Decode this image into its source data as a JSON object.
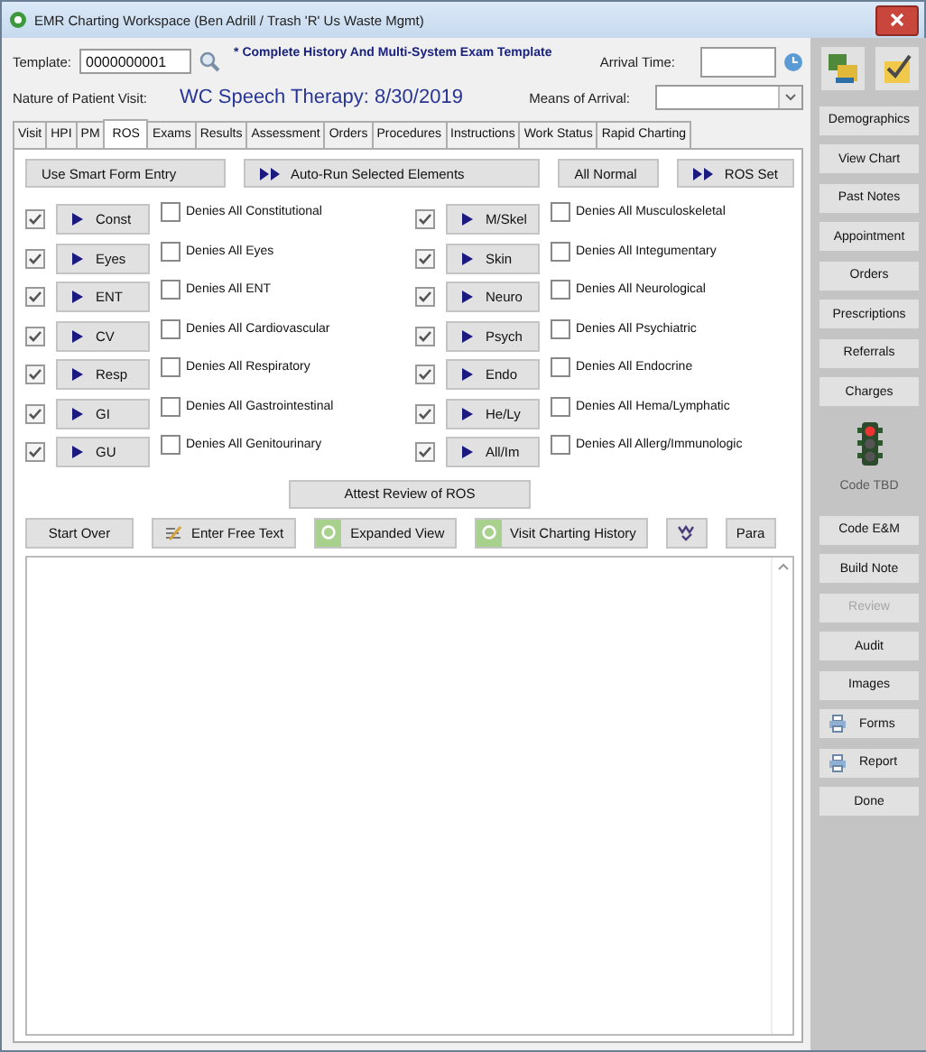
{
  "window": {
    "title": "EMR Charting Workspace (Ben Adrill / Trash 'R' Us Waste Mgmt)"
  },
  "header": {
    "template_label": "Template:",
    "template_value": "0000000001",
    "template_name": "* Complete History And Multi-System Exam Template",
    "arrival_time_label": "Arrival Time:",
    "nature_label": "Nature of Patient Visit:",
    "nature_value": "WC Speech Therapy:  8/30/2019",
    "means_label": "Means of Arrival:"
  },
  "tabs": [
    {
      "label": "Visit",
      "selected": false
    },
    {
      "label": "HPI",
      "selected": false
    },
    {
      "label": "PM",
      "selected": false
    },
    {
      "label": "ROS",
      "selected": true
    },
    {
      "label": "Exams",
      "selected": false
    },
    {
      "label": "Results",
      "selected": false
    },
    {
      "label": "Assessment",
      "selected": false
    },
    {
      "label": "Orders",
      "selected": false
    },
    {
      "label": "Procedures",
      "selected": false
    },
    {
      "label": "Instructions",
      "selected": false
    },
    {
      "label": "Work Status",
      "selected": false
    },
    {
      "label": "Rapid Charting",
      "selected": false
    }
  ],
  "ros_buttons": [
    {
      "label": "Use Smart Form Entry",
      "kind": "plain"
    },
    {
      "label": "Auto-Run Selected Elements",
      "kind": "run"
    },
    {
      "label": "All Normal",
      "kind": "plain"
    },
    {
      "label": "ROS Set",
      "kind": "run"
    }
  ],
  "systems": [
    {
      "label": "Const",
      "checked": true,
      "denies": "Denies All Constitutional",
      "denies_checked": false
    },
    {
      "label": "Eyes",
      "checked": true,
      "denies": "Denies All Eyes",
      "denies_checked": false
    },
    {
      "label": "ENT",
      "checked": true,
      "denies": "Denies All ENT",
      "denies_checked": false
    },
    {
      "label": "CV",
      "checked": true,
      "denies": "Denies All Cardiovascular",
      "denies_checked": false
    },
    {
      "label": "Resp",
      "checked": true,
      "denies": "Denies All Respiratory",
      "denies_checked": false
    },
    {
      "label": "GI",
      "checked": true,
      "denies": "Denies All Gastrointestinal",
      "denies_checked": false
    },
    {
      "label": "GU",
      "checked": true,
      "denies": "Denies All Genitourinary",
      "denies_checked": false
    },
    {
      "label": "M/Skel",
      "checked": true,
      "denies": "Denies All Musculoskeletal",
      "denies_checked": false
    },
    {
      "label": "Skin",
      "checked": true,
      "denies": "Denies All Integumentary",
      "denies_checked": false
    },
    {
      "label": "Neuro",
      "checked": true,
      "denies": "Denies All Neurological",
      "denies_checked": false
    },
    {
      "label": "Psych",
      "checked": true,
      "denies": "Denies All Psychiatric",
      "denies_checked": false
    },
    {
      "label": "Endo",
      "checked": true,
      "denies": "Denies All Endocrine",
      "denies_checked": false
    },
    {
      "label": "He/Ly",
      "checked": true,
      "denies": "Denies All Hema/Lymphatic",
      "denies_checked": false
    },
    {
      "label": "All/Im",
      "checked": true,
      "denies": "Denies All Allerg/Immunologic",
      "denies_checked": false
    }
  ],
  "attest_button": "Attest Review of ROS",
  "toolbar": [
    {
      "label": "Start Over",
      "kind": "plain"
    },
    {
      "label": "Enter Free Text",
      "kind": "pen"
    },
    {
      "label": "Expanded View",
      "kind": "green"
    },
    {
      "label": "Visit Charting History",
      "kind": "green"
    },
    {
      "kind": "spell"
    },
    {
      "label": "Para",
      "kind": "plain"
    }
  ],
  "sidebar": [
    {
      "label": "Demographics",
      "kind": "button",
      "disabled": false
    },
    {
      "label": "View Chart",
      "kind": "button",
      "disabled": false
    },
    {
      "label": "Past Notes",
      "kind": "button",
      "disabled": false
    },
    {
      "label": "Appointment",
      "kind": "button",
      "disabled": false
    },
    {
      "label": "Orders",
      "kind": "button",
      "disabled": false
    },
    {
      "label": "Prescriptions",
      "kind": "button",
      "disabled": false
    },
    {
      "label": "Referrals",
      "kind": "button",
      "disabled": false
    },
    {
      "label": "Charges",
      "kind": "button",
      "disabled": false
    },
    {
      "kind": "light"
    },
    {
      "label": "Code TBD",
      "kind": "status"
    },
    {
      "label": "Code E&M",
      "kind": "button",
      "disabled": false
    },
    {
      "label": "Build Note",
      "kind": "button",
      "disabled": false
    },
    {
      "label": "Review",
      "kind": "button",
      "disabled": true
    },
    {
      "label": "Audit",
      "kind": "button",
      "disabled": false
    },
    {
      "label": "Images",
      "kind": "button",
      "disabled": false
    },
    {
      "label": "Forms",
      "kind": "printer",
      "disabled": false
    },
    {
      "label": "Report",
      "kind": "printer",
      "disabled": false
    },
    {
      "label": "Done",
      "kind": "button",
      "disabled": false
    }
  ]
}
